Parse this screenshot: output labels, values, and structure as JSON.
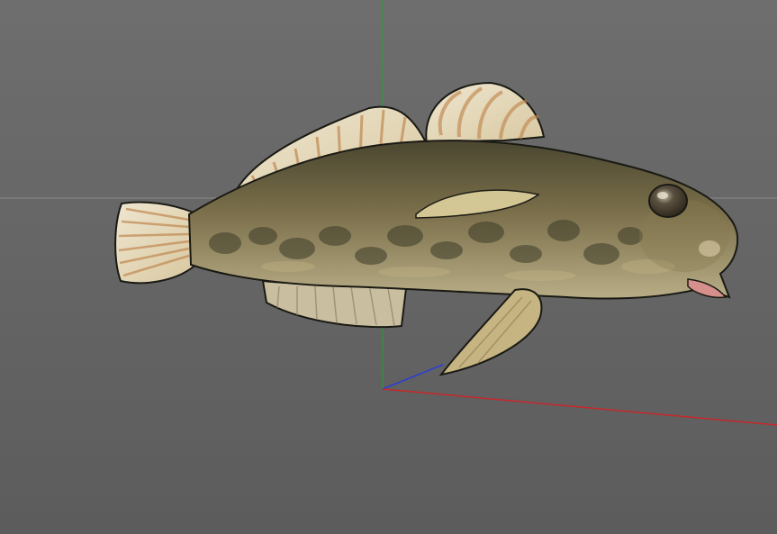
{
  "viewport": {
    "background_top": "#6e6e6e",
    "background_bottom": "#5c5c5c"
  },
  "grid": {
    "color": "#8a8a8a",
    "shown": true
  },
  "axes": {
    "x_color": "#c8262a",
    "y_color": "#23a03a",
    "z_color": "#2c3fd0"
  },
  "model": {
    "icon": "goby-fish-3d-model",
    "colors": {
      "body_dark": "#4a4630",
      "body_mid": "#7a6f4a",
      "body_light": "#a99a6c",
      "belly": "#b8ad86",
      "fin_base": "#d8c8a0",
      "fin_light": "#efe6d0",
      "fin_ray": "#c08850",
      "outline": "#1a1a14",
      "eye": "#2a2418",
      "mouth": "#d78f8c"
    }
  }
}
